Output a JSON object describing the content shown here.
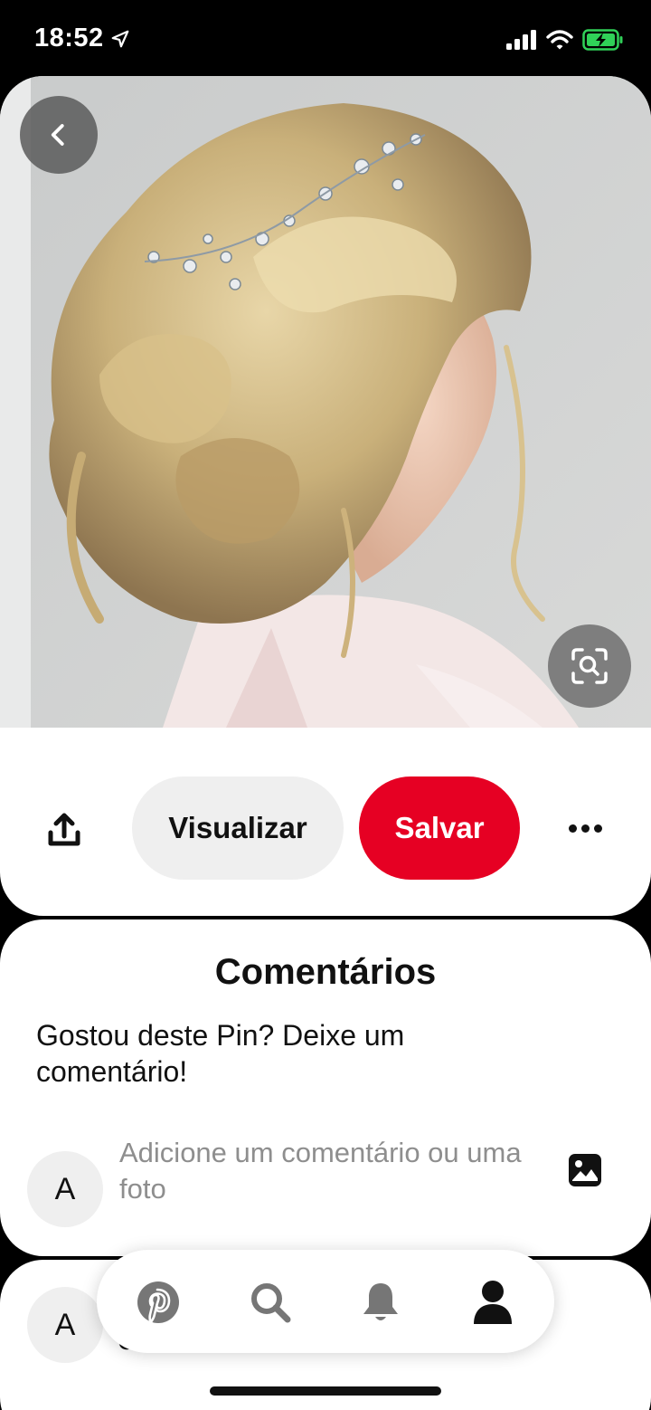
{
  "status_bar": {
    "time": "18:52",
    "icons": [
      "location-arrow-icon",
      "signal-icon",
      "wifi-icon",
      "battery-charging-icon"
    ],
    "battery_color": "#30d158"
  },
  "pin": {
    "image_subject": "",
    "icons": {
      "back": "chevron-left-icon",
      "visual_search": "visual-search-icon"
    }
  },
  "actions": {
    "share_icon": "share-icon",
    "visit_label": "Visualizar",
    "save_label": "Salvar",
    "more_icon": "ellipsis-icon"
  },
  "comments": {
    "title": "Comentários",
    "prompt": "Gostou deste Pin? Deixe um comentário!",
    "avatar_initial": "A",
    "input_placeholder": "Adicione um comentário ou uma foto",
    "photo_icon": "photo-icon"
  },
  "next_card": {
    "avatar_initial": "A",
    "partial_text": "casamento"
  },
  "bottom_nav": {
    "items": [
      "pinterest-home-icon",
      "search-icon",
      "notifications-bell-icon",
      "profile-icon"
    ],
    "active_color": "#111111",
    "inactive_color": "#767676"
  },
  "colors": {
    "brand_red": "#e60023",
    "button_grey": "#efefef"
  }
}
